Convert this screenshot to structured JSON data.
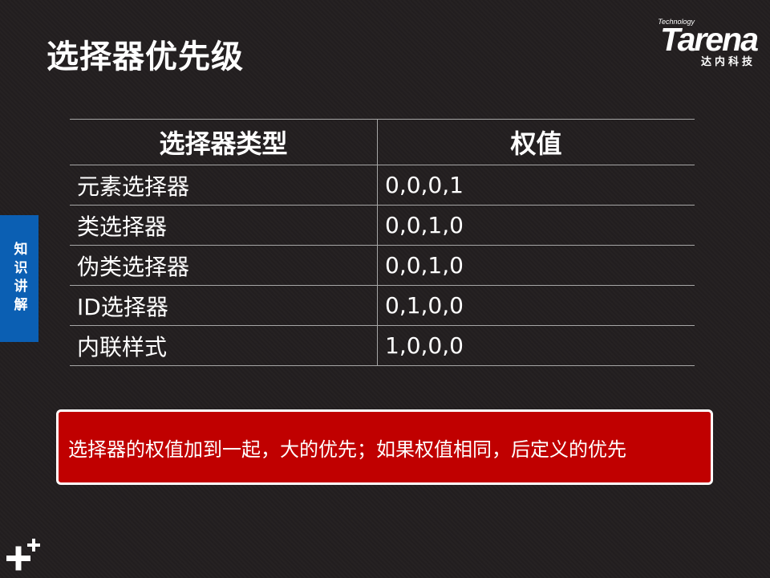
{
  "slide": {
    "title": "选择器优先级"
  },
  "logo": {
    "technology": "Technology",
    "brand": "Tarena",
    "chinese": "达内科技"
  },
  "side_tab": {
    "label": "知识讲解"
  },
  "table": {
    "headers": [
      "选择器类型",
      "权值"
    ],
    "rows": [
      [
        "元素选择器",
        "0,0,0,1"
      ],
      [
        "类选择器",
        "0,0,1,0"
      ],
      [
        "伪类选择器",
        "0,0,1,0"
      ],
      [
        "ID选择器",
        "0,1,0,0"
      ],
      [
        "内联样式",
        "1,0,0,0"
      ]
    ]
  },
  "note": {
    "text": "选择器的权值加到一起，大的优先；如果权值相同，后定义的优先"
  },
  "colors": {
    "background": "#231f20",
    "side_tab": "#0b5fb3",
    "note_box": "#c00000"
  },
  "icons": {
    "corner": "plus-icon"
  }
}
